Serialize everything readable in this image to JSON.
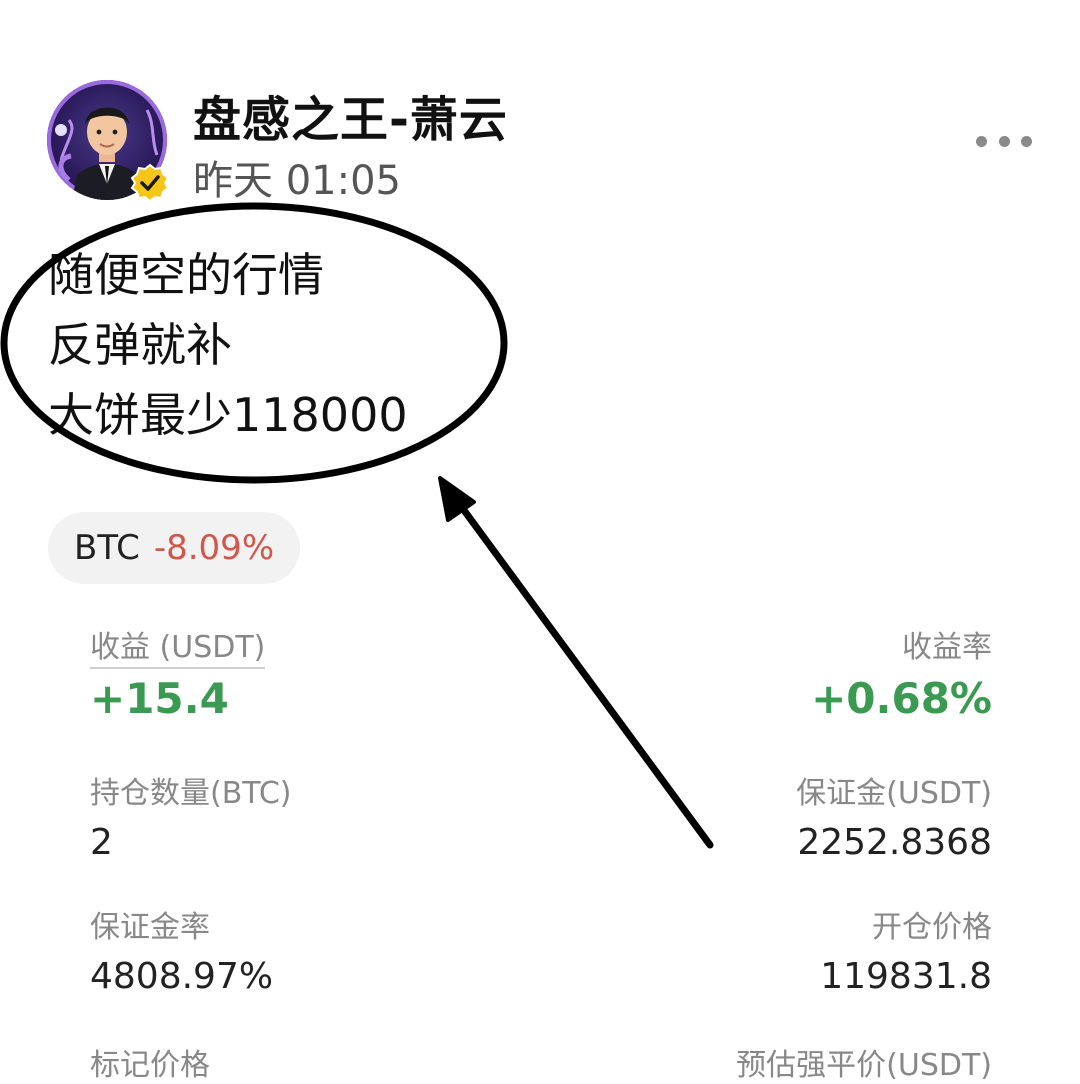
{
  "post": {
    "author_name": "盘感之王-萧云",
    "timestamp": "昨天 01:05",
    "lines": [
      "随便空的行情",
      "反弹就补",
      "大饼最少118000"
    ]
  },
  "ticker": {
    "symbol": "BTC",
    "change": "-8.09%",
    "change_color": "#d0574a"
  },
  "position": {
    "pnl_label": "收益 (USDT)",
    "pnl_value": "+15.4",
    "roi_label": "收益率",
    "roi_value": "+0.68%",
    "size_label": "持仓数量(BTC)",
    "size_value": "2",
    "margin_label": "保证金(USDT)",
    "margin_value": "2252.8368",
    "margin_ratio_label": "保证金率",
    "margin_ratio_value": "4808.97%",
    "entry_price_label": "开仓价格",
    "entry_price_value": "119831.8",
    "mark_price_label": "标记价格",
    "liq_price_label": "预估强平价(USDT)"
  },
  "icons": {
    "more": "more-dots-icon",
    "verified": "verified-badge-icon",
    "avatar": "avatar"
  },
  "colors": {
    "positive": "#3b9a52",
    "negative": "#d0574a"
  }
}
